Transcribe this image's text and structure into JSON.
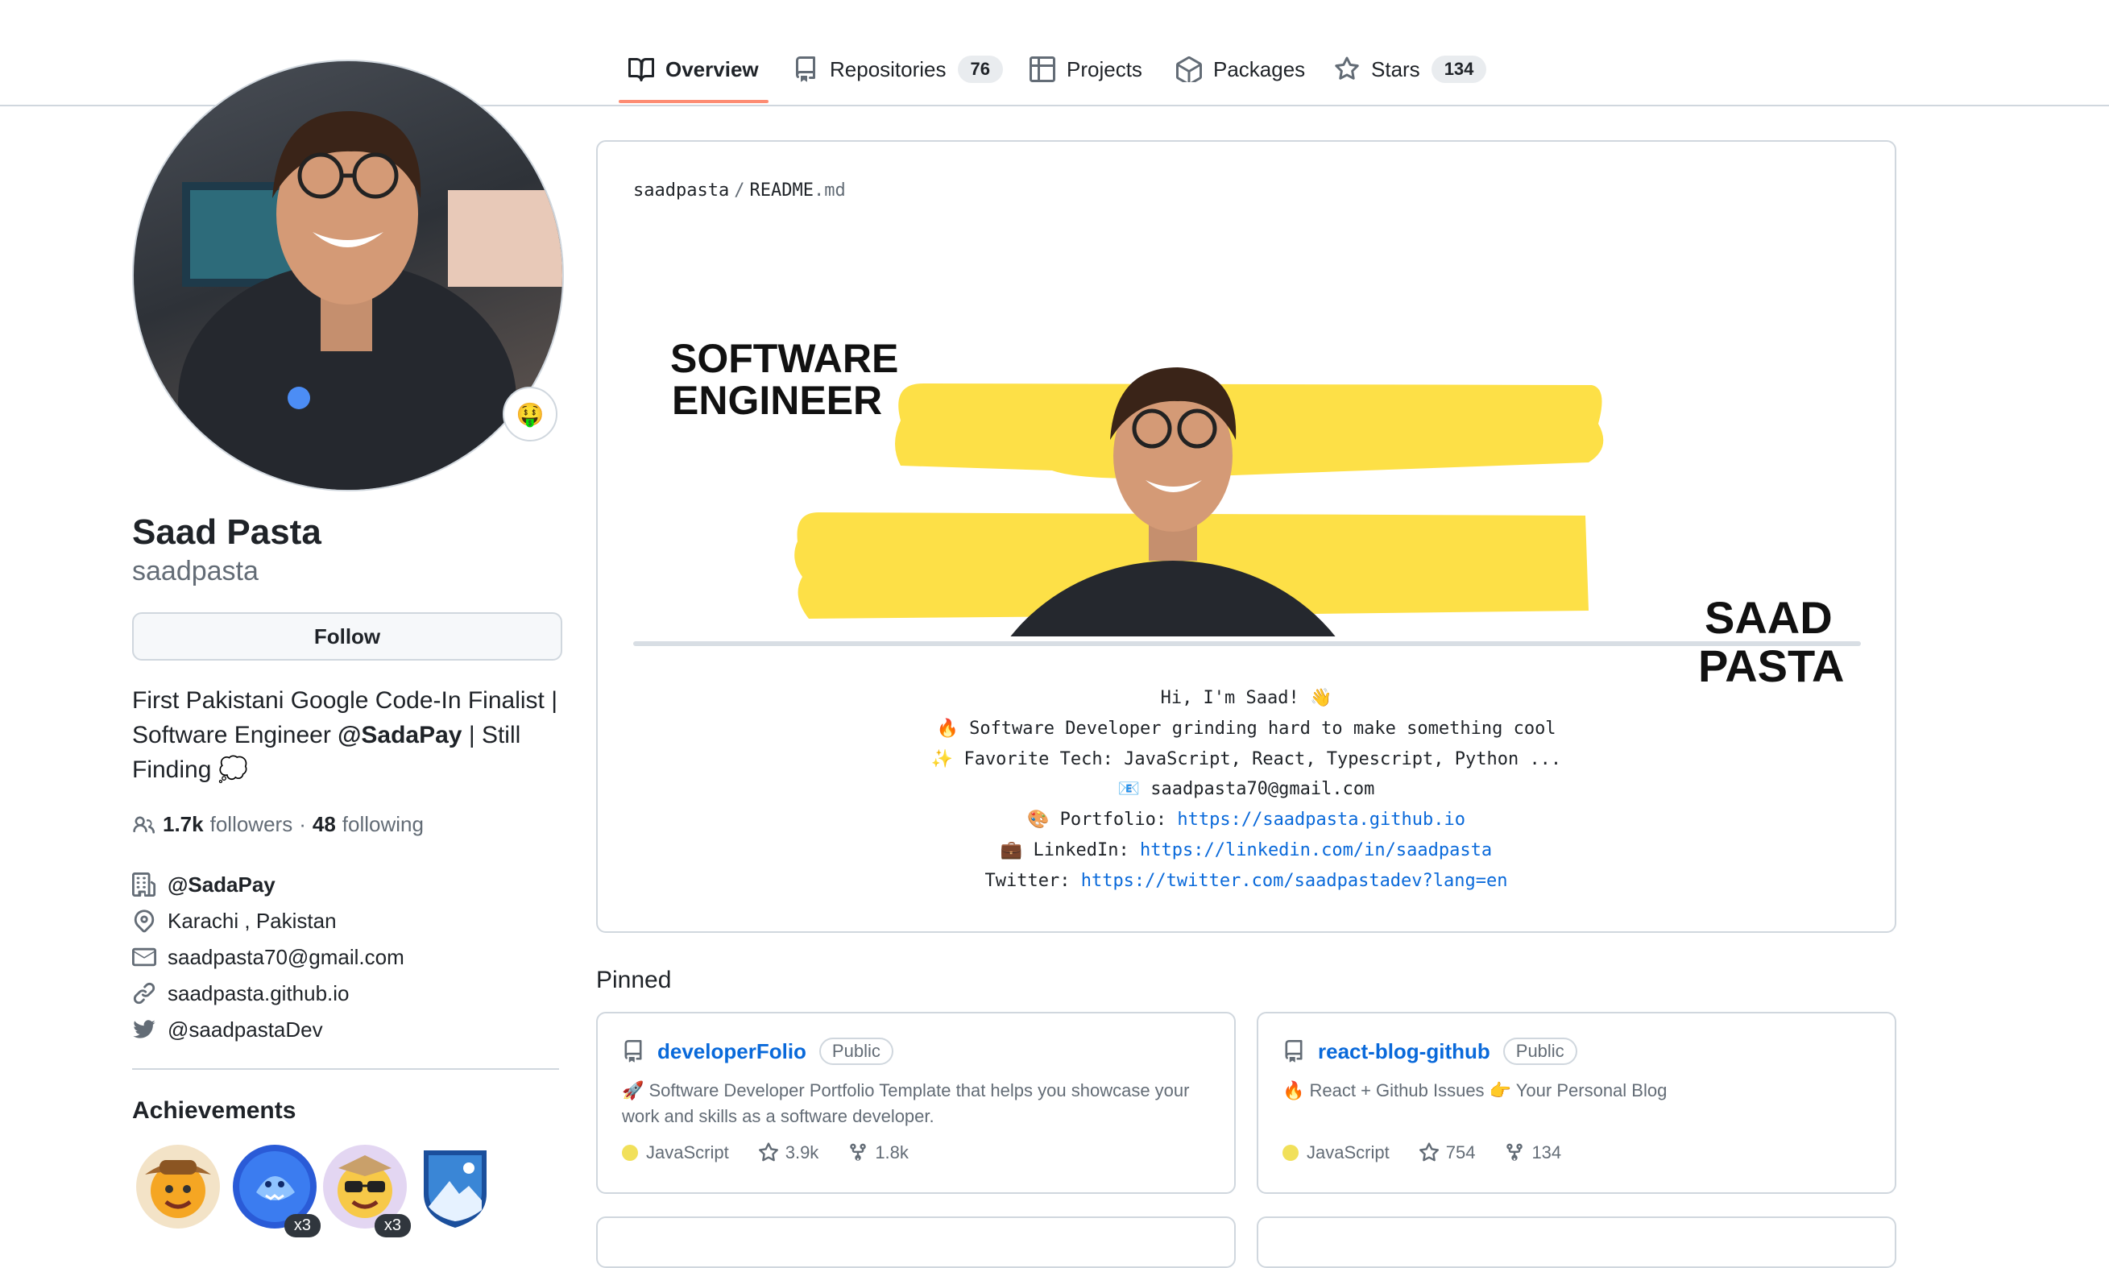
{
  "nav": {
    "tabs": [
      {
        "label": "Overview",
        "icon": "book-icon"
      },
      {
        "label": "Repositories",
        "count": "76",
        "icon": "repo-icon"
      },
      {
        "label": "Projects",
        "icon": "table-icon"
      },
      {
        "label": "Packages",
        "icon": "package-icon"
      },
      {
        "label": "Stars",
        "count": "134",
        "icon": "star-icon"
      }
    ]
  },
  "profile": {
    "name": "Saad Pasta",
    "username": "saadpasta",
    "status_emoji": "🤑",
    "follow_label": "Follow",
    "bio_part1": "First Pakistani Google Code-In Finalist | Software Engineer ",
    "bio_mention": "@SadaPay",
    "bio_part2": " | Still Finding 💭",
    "followers_count": "1.7k",
    "followers_label": "followers",
    "separator": "·",
    "following_count": "48",
    "following_label": "following",
    "company": "@SadaPay",
    "location": "Karachi , Pakistan",
    "email": "saadpasta70@gmail.com",
    "website": "saadpasta.github.io",
    "twitter": "@saadpastaDev"
  },
  "achievements": {
    "title": "Achievements",
    "badges": [
      {
        "name": "pull-shark",
        "emoji": "🤠",
        "multiplier": ""
      },
      {
        "name": "shark",
        "emoji": "🦈",
        "multiplier": "x3"
      },
      {
        "name": "quickdraw",
        "emoji": "😎",
        "multiplier": "x3"
      },
      {
        "name": "arctic",
        "emoji": "🏔",
        "multiplier": ""
      }
    ]
  },
  "readme": {
    "owner": "saadpasta",
    "slash": "/",
    "file": "README",
    "ext": ".md",
    "banner_line1": "SOFTWARE",
    "banner_line2": "ENGINEER",
    "banner_name1": "SAAD",
    "banner_name2": "PASTA",
    "greeting": "Hi, I'm Saad! 👋",
    "line2": "🔥 Software Developer grinding hard to make something cool",
    "line3": "✨ Favorite Tech: JavaScript, React, Typescript, Python ...",
    "line4": "📧 saadpasta70@gmail.com",
    "portfolio_label": "🎨 Portfolio: ",
    "portfolio_url": "https://saadpasta.github.io",
    "linkedin_label": "💼 LinkedIn: ",
    "linkedin_url": "https://linkedin.com/in/saadpasta",
    "twitter_label": "Twitter: ",
    "twitter_url": "https://twitter.com/saadpastadev?lang=en"
  },
  "pinned": {
    "title": "Pinned",
    "repos": [
      {
        "name": "developerFolio",
        "visibility": "Public",
        "description": "🚀 Software Developer Portfolio Template that helps you showcase your work and skills as a software developer.",
        "language": "JavaScript",
        "language_color": "#f1e05a",
        "stars": "3.9k",
        "forks": "1.8k"
      },
      {
        "name": "react-blog-github",
        "visibility": "Public",
        "description": "🔥 React + Github Issues 👉 Your Personal Blog",
        "language": "JavaScript",
        "language_color": "#f1e05a",
        "stars": "754",
        "forks": "134"
      }
    ]
  },
  "colors": {
    "accent_underline": "#fd8c73",
    "link": "#0969da",
    "banner_yellow": "#fde047",
    "border": "#d0d7de"
  }
}
